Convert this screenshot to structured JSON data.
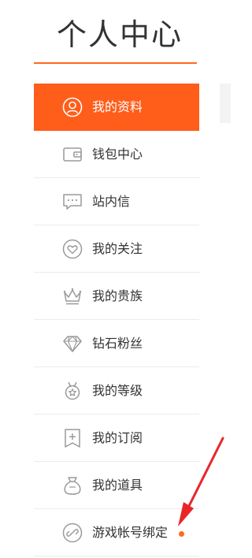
{
  "page_title": "个人中心",
  "colors": {
    "accent": "#ff5d1a",
    "text": "#333333",
    "icon": "#9a9a9a",
    "divider": "#ececec",
    "annotation_arrow": "#e8262a"
  },
  "menu": [
    {
      "label": "我的资料",
      "icon": "user-circle-icon",
      "active": true
    },
    {
      "label": "钱包中心",
      "icon": "wallet-icon",
      "active": false
    },
    {
      "label": "站内信",
      "icon": "message-bubble-icon",
      "active": false
    },
    {
      "label": "我的关注",
      "icon": "heart-circle-icon",
      "active": false
    },
    {
      "label": "我的贵族",
      "icon": "crown-icon",
      "active": false
    },
    {
      "label": "钻石粉丝",
      "icon": "diamond-icon",
      "active": false
    },
    {
      "label": "我的等级",
      "icon": "medal-icon",
      "active": false
    },
    {
      "label": "我的订阅",
      "icon": "bookmark-plus-icon",
      "active": false
    },
    {
      "label": "我的道具",
      "icon": "bag-icon",
      "active": false
    },
    {
      "label": "游戏帐号绑定",
      "icon": "link-icon",
      "active": false,
      "has_notification_dot": true
    }
  ]
}
